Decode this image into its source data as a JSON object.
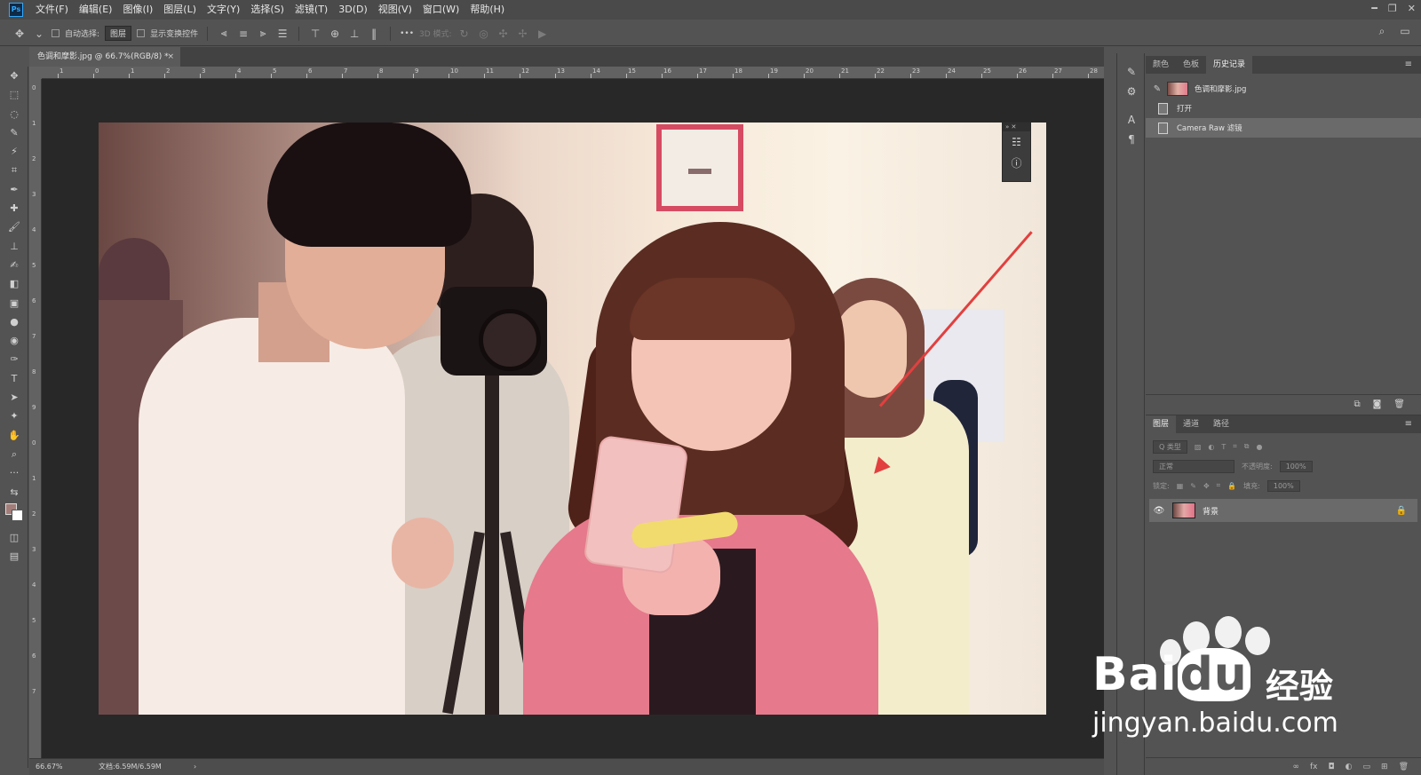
{
  "app": {
    "logo": "Ps"
  },
  "menu": [
    "文件(F)",
    "编辑(E)",
    "图像(I)",
    "图层(L)",
    "文字(Y)",
    "选择(S)",
    "滤镜(T)",
    "3D(D)",
    "视图(V)",
    "窗口(W)",
    "帮助(H)"
  ],
  "window_controls": {
    "minimize": "━",
    "restore": "❐",
    "close": "✕"
  },
  "options": {
    "auto_select_label": "自动选择:",
    "auto_select_value": "图层",
    "show_transform_label": "显示变换控件",
    "mode_3d_label": "3D 模式:",
    "more": "•••"
  },
  "document": {
    "tab_title": "色调和摩影.jpg @ 66.7%(RGB/8) *",
    "close": "×",
    "ruler_h": [
      "1",
      "0",
      "1",
      "2",
      "3",
      "4",
      "5",
      "6",
      "7",
      "8",
      "9",
      "10",
      "11",
      "12",
      "13",
      "14",
      "15",
      "16",
      "17",
      "18",
      "19",
      "20",
      "21",
      "22",
      "23",
      "24",
      "25",
      "26",
      "27",
      "28"
    ],
    "ruler_v": [
      "0",
      "1",
      "2",
      "3",
      "4",
      "5",
      "6",
      "7",
      "8",
      "9",
      "0",
      "1",
      "2",
      "3",
      "4",
      "5",
      "6",
      "7"
    ]
  },
  "status": {
    "zoom": "66.67%",
    "doc_info": "文档:6.59M/6.59M",
    "more": "›"
  },
  "colors": {
    "foreground": "#a37d79",
    "background": "#ffffff",
    "accent": "#31a8ff",
    "arrow": "#e1403f"
  },
  "history_panel": {
    "tabs": [
      "颜色",
      "色板",
      "历史记录"
    ],
    "active_tab": "历史记录",
    "snapshot_name": "色调和摩影.jpg",
    "entries": [
      "打开",
      "Camera  Raw 滤镜"
    ],
    "selected_index": 1
  },
  "layers_panel": {
    "tabs": [
      "图层",
      "通道",
      "路径"
    ],
    "active_tab": "图层",
    "filter_label": "Q 类型",
    "blend_mode": "正常",
    "opacity_label": "不透明度:",
    "opacity_value": "100%",
    "lock_label": "锁定:",
    "fill_label": "填充:",
    "fill_value": "100%",
    "layers": [
      {
        "name": "背景",
        "visible": true,
        "locked": true
      }
    ]
  },
  "watermark": {
    "brand": "Bai",
    "brand_tail": "du",
    "product": "经验",
    "url": "jingyan.baidu.com"
  }
}
